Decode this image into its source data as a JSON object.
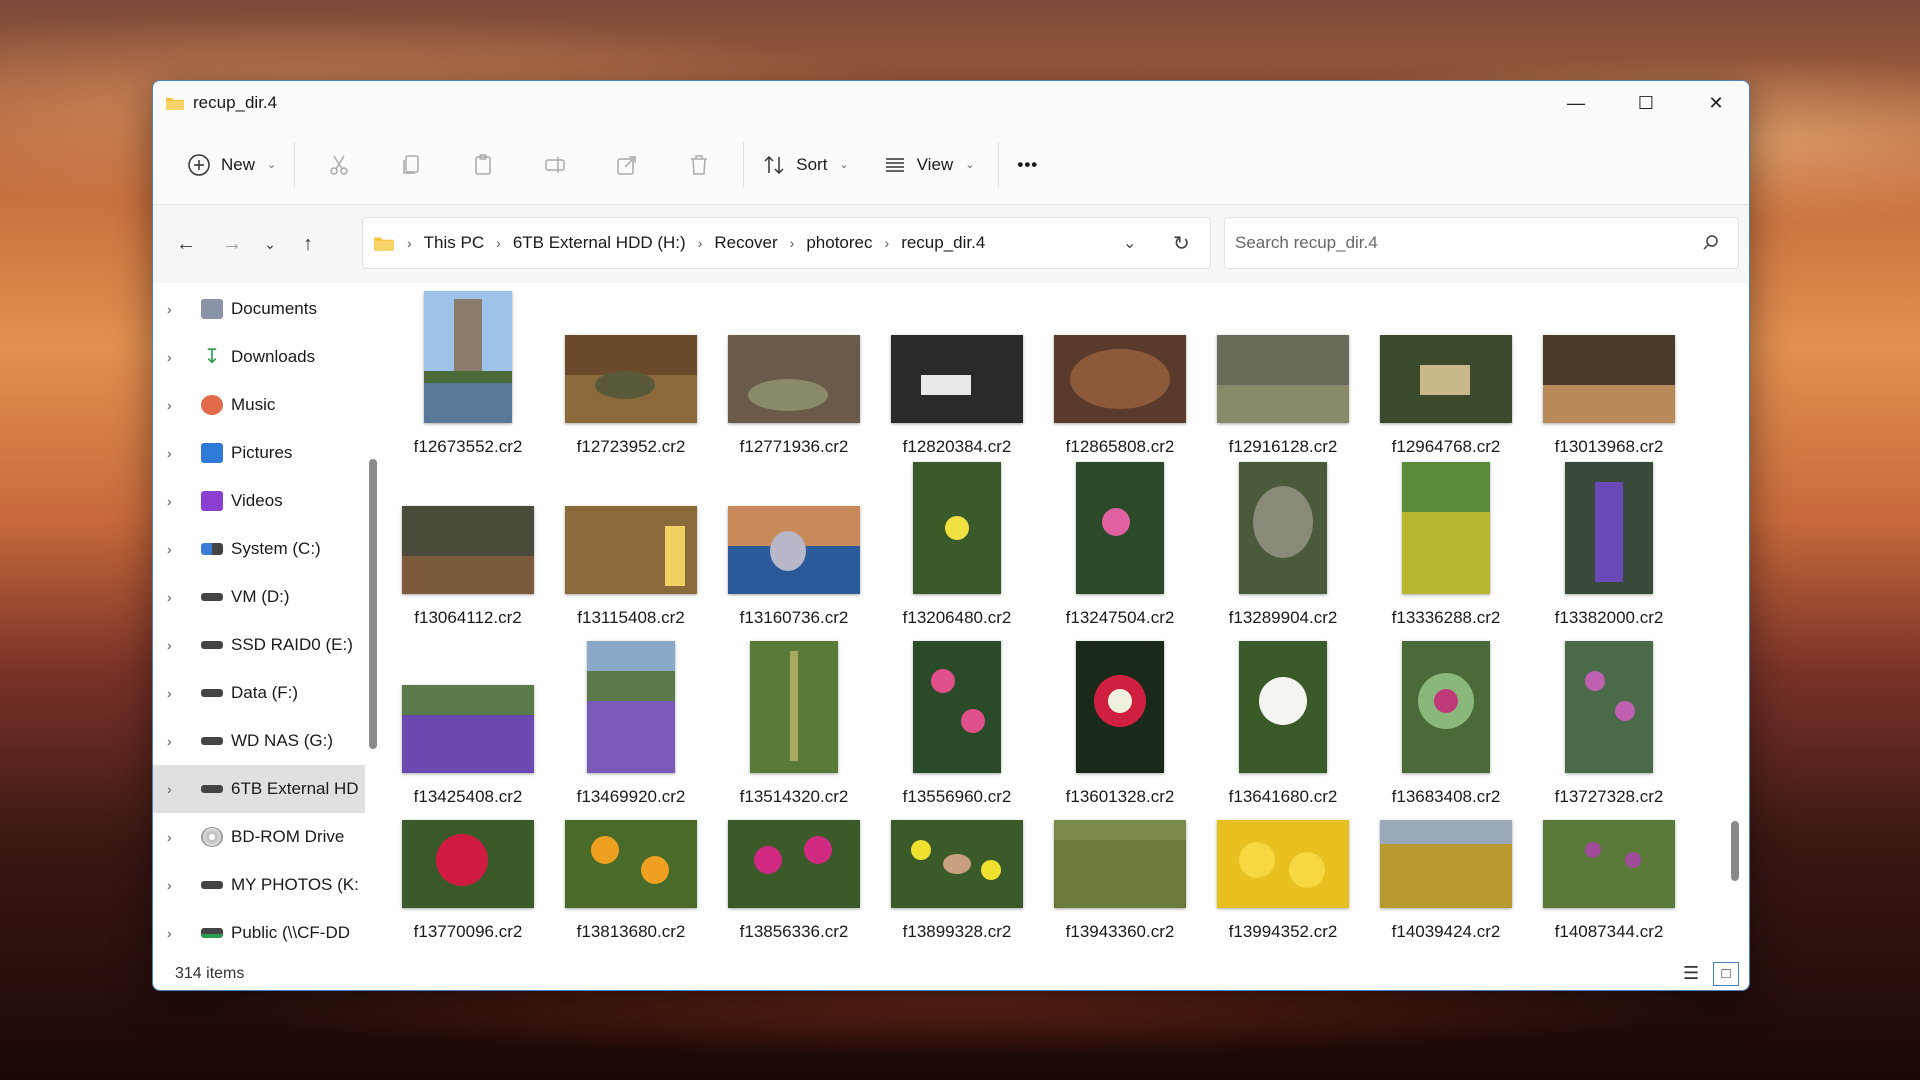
{
  "window": {
    "title": "recup_dir.4",
    "accent": "#4a7fc0",
    "folder_color": "#f5c242"
  },
  "window_controls": {
    "minimize": "—",
    "maximize": "☐",
    "close": "✕"
  },
  "toolbar": {
    "new_label": "New",
    "sort_label": "Sort",
    "view_label": "View",
    "more_label": "•••"
  },
  "address": {
    "crumbs": [
      "This PC",
      "6TB External HDD (H:)",
      "Recover",
      "photorec",
      "recup_dir.4"
    ]
  },
  "search": {
    "placeholder": "Search recup_dir.4"
  },
  "sidebar": {
    "items": [
      {
        "label": "Documents",
        "icon": "documents-icon"
      },
      {
        "label": "Downloads",
        "icon": "downloads-icon"
      },
      {
        "label": "Music",
        "icon": "music-icon"
      },
      {
        "label": "Pictures",
        "icon": "pictures-icon"
      },
      {
        "label": "Videos",
        "icon": "videos-icon"
      },
      {
        "label": "System (C:)",
        "icon": "system-drive-icon"
      },
      {
        "label": "VM (D:)",
        "icon": "drive-icon"
      },
      {
        "label": "SSD RAID0 (E:)",
        "icon": "drive-icon"
      },
      {
        "label": "Data (F:)",
        "icon": "drive-icon"
      },
      {
        "label": "WD NAS (G:)",
        "icon": "drive-icon"
      },
      {
        "label": "6TB External HD",
        "icon": "drive-icon"
      },
      {
        "label": "BD-ROM Drive",
        "icon": "disc-icon"
      },
      {
        "label": "MY PHOTOS (K:",
        "icon": "drive-icon"
      },
      {
        "label": "Public (\\\\CF-DD",
        "icon": "network-drive-icon"
      }
    ]
  },
  "files": [
    {
      "name": "f12673552.cr2"
    },
    {
      "name": "f12723952.cr2"
    },
    {
      "name": "f12771936.cr2"
    },
    {
      "name": "f12820384.cr2"
    },
    {
      "name": "f12865808.cr2"
    },
    {
      "name": "f12916128.cr2"
    },
    {
      "name": "f12964768.cr2"
    },
    {
      "name": "f13013968.cr2"
    },
    {
      "name": "f13064112.cr2"
    },
    {
      "name": "f13115408.cr2"
    },
    {
      "name": "f13160736.cr2"
    },
    {
      "name": "f13206480.cr2"
    },
    {
      "name": "f13247504.cr2"
    },
    {
      "name": "f13289904.cr2"
    },
    {
      "name": "f13336288.cr2"
    },
    {
      "name": "f13382000.cr2"
    },
    {
      "name": "f13425408.cr2"
    },
    {
      "name": "f13469920.cr2"
    },
    {
      "name": "f13514320.cr2"
    },
    {
      "name": "f13556960.cr2"
    },
    {
      "name": "f13601328.cr2"
    },
    {
      "name": "f13641680.cr2"
    },
    {
      "name": "f13683408.cr2"
    },
    {
      "name": "f13727328.cr2"
    },
    {
      "name": "f13770096.cr2"
    },
    {
      "name": "f13813680.cr2"
    },
    {
      "name": "f13856336.cr2"
    },
    {
      "name": "f13899328.cr2"
    },
    {
      "name": "f13943360.cr2"
    },
    {
      "name": "f13994352.cr2"
    },
    {
      "name": "f14039424.cr2"
    },
    {
      "name": "f14087344.cr2"
    }
  ],
  "status": {
    "count": "314 items"
  }
}
